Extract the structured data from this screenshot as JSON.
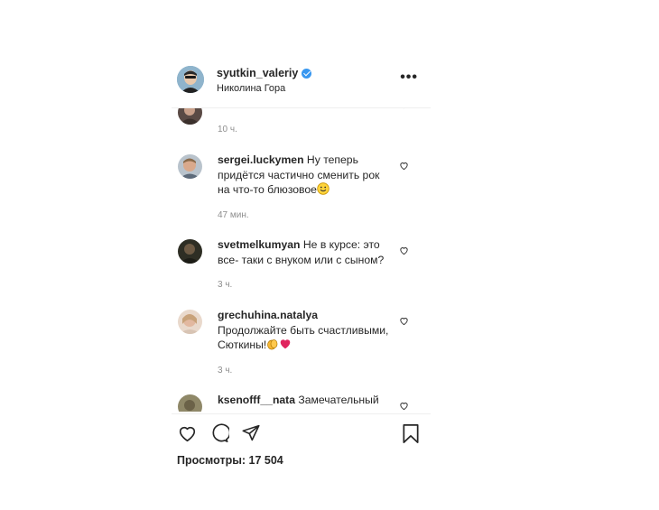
{
  "post": {
    "username": "syutkin_valeriy",
    "location": "Николина Гора",
    "more_label": "•••"
  },
  "comments": [
    {
      "username": "",
      "text": "",
      "time": "10 ч."
    },
    {
      "username": "sergei.luckymen",
      "text": "Ну теперь придётся частично сменить рок на что-то блюзовое",
      "time": "47 мин."
    },
    {
      "username": "svetmelkumyan",
      "text": "Не в курсе: это все- таки с внуком или с сыном?",
      "time": "3 ч."
    },
    {
      "username": "grechuhina.natalya",
      "text": "Продолжайте быть счастливыми, Сюткины!",
      "time": "3 ч."
    },
    {
      "username": "ksenofff__nata",
      "text": "Замечательный",
      "time": ""
    }
  ],
  "views": "Просмотры: 17 504",
  "icons": [
    "verified-icon",
    "more-icon",
    "heart-icon",
    "comment-icon",
    "share-icon",
    "bookmark-icon"
  ],
  "colors": {
    "verified": "#3897f0",
    "muted": "#8e8e8e",
    "text": "#262626"
  }
}
